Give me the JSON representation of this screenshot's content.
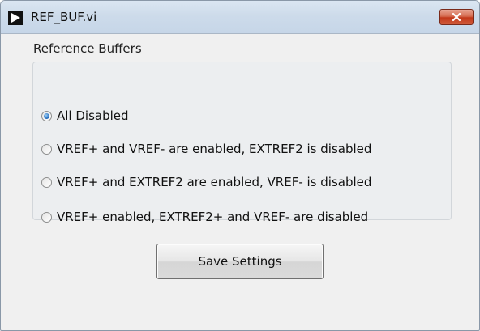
{
  "window": {
    "title": "REF_BUF.vi"
  },
  "group": {
    "label": "Reference Buffers",
    "options": [
      {
        "label": "All Disabled",
        "selected": true
      },
      {
        "label": "VREF+ and VREF- are enabled, EXTREF2 is disabled",
        "selected": false
      },
      {
        "label": "VREF+ and EXTREF2 are enabled, VREF- is disabled",
        "selected": false
      },
      {
        "label": "VREF+ enabled, EXTREF2+ and VREF- are disabled",
        "selected": false
      }
    ]
  },
  "actions": {
    "save_label": "Save Settings"
  },
  "icons": {
    "app": "labview-run-arrow-icon",
    "close": "close-icon"
  },
  "colors": {
    "close_button": "#c2381a",
    "selected_radio": "#2a73c4"
  }
}
